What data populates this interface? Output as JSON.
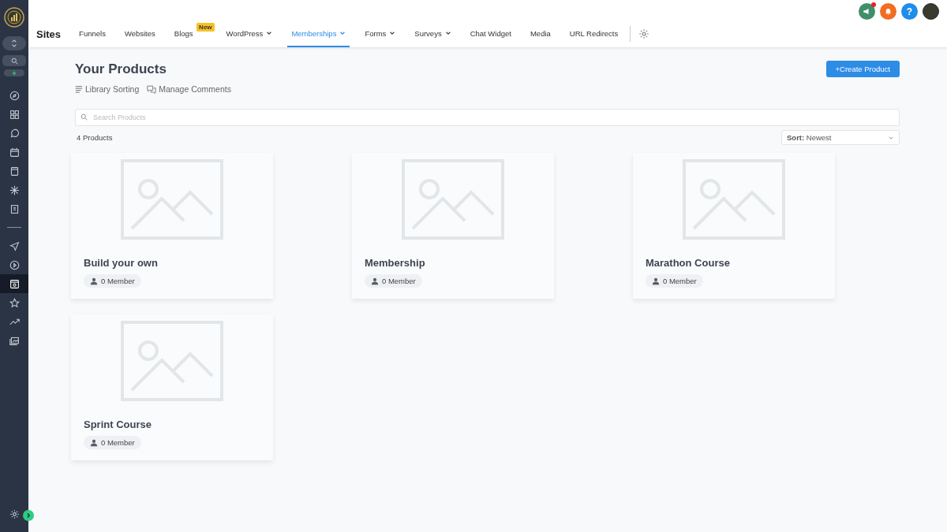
{
  "sidebar": {
    "items": [
      {
        "kind": "compass",
        "selected": false
      },
      {
        "kind": "grid",
        "selected": false
      },
      {
        "kind": "chat",
        "selected": false
      },
      {
        "kind": "calendar",
        "selected": false
      },
      {
        "kind": "book",
        "selected": false
      },
      {
        "kind": "network",
        "selected": false
      },
      {
        "kind": "invoice",
        "selected": false
      }
    ],
    "lower_items": [
      {
        "kind": "send",
        "selected": false
      },
      {
        "kind": "play",
        "selected": false
      },
      {
        "kind": "site",
        "selected": true
      },
      {
        "kind": "star",
        "selected": false
      },
      {
        "kind": "trend",
        "selected": false
      },
      {
        "kind": "gallery",
        "selected": false
      }
    ]
  },
  "header": {
    "title": "Sites",
    "tabs": [
      {
        "label": "Funnels",
        "dropdown": false,
        "selected": false
      },
      {
        "label": "Websites",
        "dropdown": false,
        "selected": false
      },
      {
        "label": "Blogs",
        "badge": "New",
        "dropdown": false,
        "selected": false
      },
      {
        "label": "WordPress",
        "dropdown": true,
        "selected": false
      },
      {
        "label": "Memberships",
        "dropdown": true,
        "selected": true
      },
      {
        "label": "Forms",
        "dropdown": true,
        "selected": false
      },
      {
        "label": "Surveys",
        "dropdown": true,
        "selected": false
      },
      {
        "label": "Chat Widget",
        "dropdown": false,
        "selected": false
      },
      {
        "label": "Media",
        "dropdown": false,
        "selected": false
      },
      {
        "label": "URL Redirects",
        "dropdown": false,
        "selected": false
      }
    ],
    "help_label": "?"
  },
  "page": {
    "title": "Your Products",
    "links": [
      {
        "kind": "sort",
        "label": "Library Sorting"
      },
      {
        "kind": "comments",
        "label": "Manage Comments"
      }
    ],
    "create_button": "+Create Product",
    "search": {
      "placeholder": "Search Products"
    },
    "count": "4 Products",
    "sort": {
      "label": "Sort:",
      "value": "Newest"
    },
    "products": [
      {
        "name": "Build your own",
        "members": "0 Member"
      },
      {
        "name": "Membership",
        "members": "0 Member"
      },
      {
        "name": "Marathon Course",
        "members": "0 Member"
      },
      {
        "name": "Sprint Course",
        "members": "0 Member"
      }
    ]
  }
}
